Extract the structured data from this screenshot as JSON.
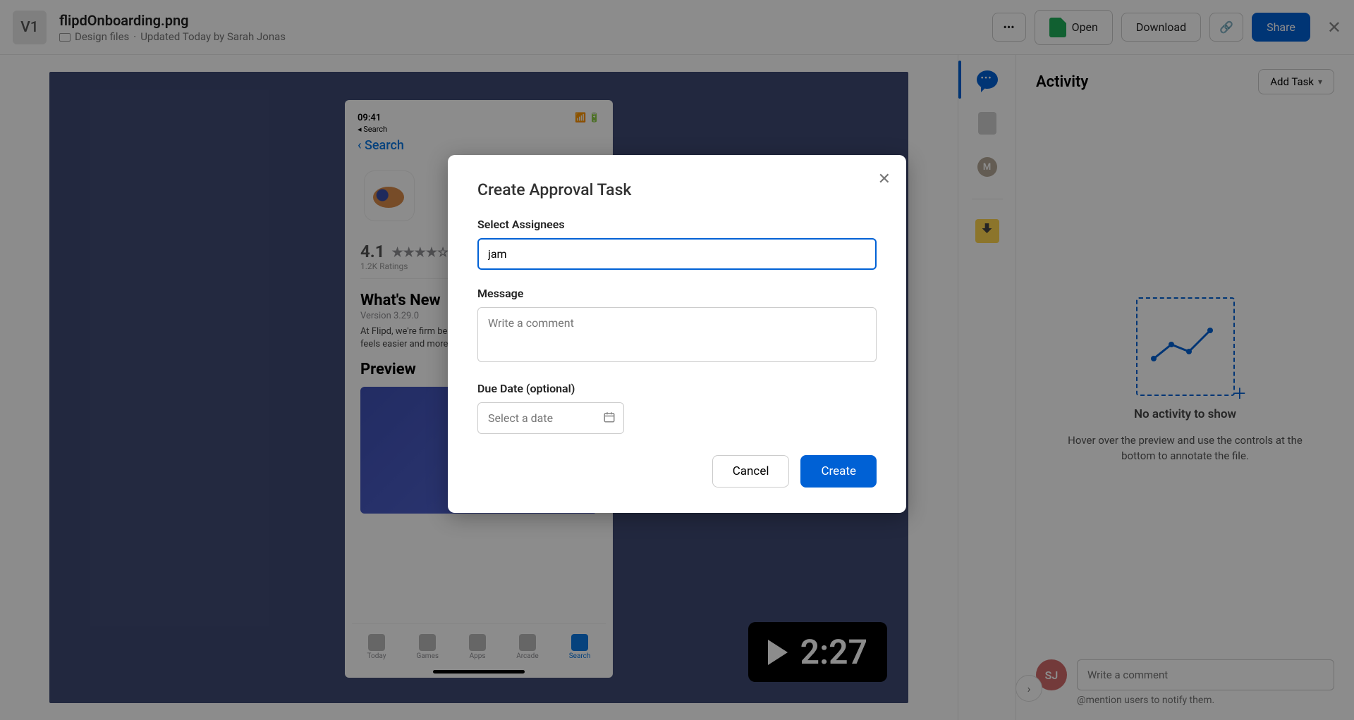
{
  "header": {
    "version_badge": "V1",
    "file_name": "flipdOnboarding.png",
    "folder": "Design files",
    "updated": "Updated Today by Sarah Jonas",
    "open": "Open",
    "download": "Download",
    "share": "Share"
  },
  "phone": {
    "time": "09:41",
    "back_crumb": "◂ Search",
    "search_link": "Search",
    "rating_value": "4.1",
    "rating_count": "1.2K Ratings",
    "whats_new": "What's New",
    "version": "Version 3.29.0",
    "body": "At Flipd, we're firm believers that achieving those goals feels easier and more fun when you have a community",
    "preview_heading": "Preview",
    "tabs": [
      "Today",
      "Games",
      "Apps",
      "Arcade",
      "Search"
    ]
  },
  "duration": "2:27",
  "activity": {
    "title": "Activity",
    "add_task": "Add Task",
    "empty_title": "No activity to show",
    "empty_body": "Hover over the preview and use the controls at the bottom to annotate the file.",
    "avatar_initials": "SJ",
    "comment_placeholder": "Write a comment",
    "mention_hint": "@mention users to notify them."
  },
  "modal": {
    "title": "Create Approval Task",
    "assignees_label": "Select Assignees",
    "assignees_value": "jam",
    "message_label": "Message",
    "message_placeholder": "Write a comment",
    "due_label": "Due Date (optional)",
    "due_placeholder": "Select a date",
    "cancel": "Cancel",
    "create": "Create"
  }
}
